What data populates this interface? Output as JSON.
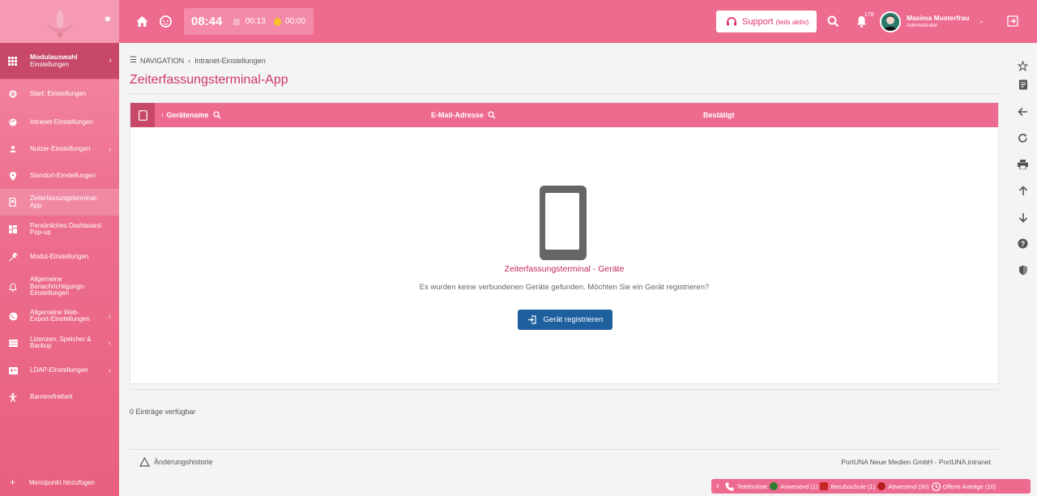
{
  "sidebar": {
    "module": {
      "title": "Modulauswahl",
      "subtitle": "Einstellungen"
    },
    "items": [
      {
        "label": "Start: Einstellungen",
        "icon": "gear-icon"
      },
      {
        "label": "Intranet-Einstellungen",
        "icon": "palette-icon"
      },
      {
        "label": "Nutzer-Einstellungen",
        "icon": "user-icon"
      },
      {
        "label": "Standort-Einstellungen",
        "icon": "location-pin-icon"
      },
      {
        "label": "Zeiterfassungsterminal-App",
        "icon": "terminal-icon"
      },
      {
        "label": "Persönliches Dashboard-Pop-up",
        "icon": "dashboard-icon"
      },
      {
        "label": "Modul-Einstellungen",
        "icon": "wrench-icon"
      },
      {
        "label": "Allgemeine Benachrichtigungs-Einstellungen",
        "icon": "bell-icon"
      },
      {
        "label": "Allgemeine Web-Export-Einstellungen",
        "icon": "globe-icon"
      },
      {
        "label": "Lizenzen, Speicher & Backup",
        "icon": "storage-icon"
      },
      {
        "label": "LDAP-Einstellungen",
        "icon": "id-card-icon"
      },
      {
        "label": "Barrierefreiheit",
        "icon": "accessibility-icon"
      }
    ],
    "add_label": "Menüpunkt hinzufügen"
  },
  "topbar": {
    "time": "08:44",
    "timer": "00:13",
    "pause": "00:00",
    "support_label": "Support",
    "support_sub": "(teils aktiv)",
    "notification_count": "178",
    "user_name": "Maxima Musterfrau",
    "user_role": "Administrator"
  },
  "breadcrumb": {
    "root": "NAVIGATION",
    "current": "Intranet-Einstellungen"
  },
  "page": {
    "title": "Zeiterfassungsterminal-App"
  },
  "table": {
    "columns": [
      "Gerätename",
      "E-Mail-Adresse",
      "Bestätigt"
    ],
    "empty_title": "Zeiterfassungsterminal - Geräte",
    "empty_text": "Es wurden keine verbundenen Geräte gefunden. Möchten Sie ein Gerät registrieren?",
    "register_label": "Gerät registrieren",
    "entries_text": "0 Einträge verfügbar"
  },
  "footer": {
    "history": "Änderungshistorie",
    "company": "PortUNA Neue Medien GmbH - PortUNA.intranet"
  },
  "statusbar": {
    "phone": "Telefonliste",
    "present": "Anwesend (1)",
    "school": "Berufsschule (1)",
    "absent": "Abwesend (30)",
    "requests": "Offene Anträge (10)"
  },
  "colors": {
    "accent": "#ee6b90",
    "primary_button": "#1e5f9e",
    "title": "#d0386a"
  }
}
